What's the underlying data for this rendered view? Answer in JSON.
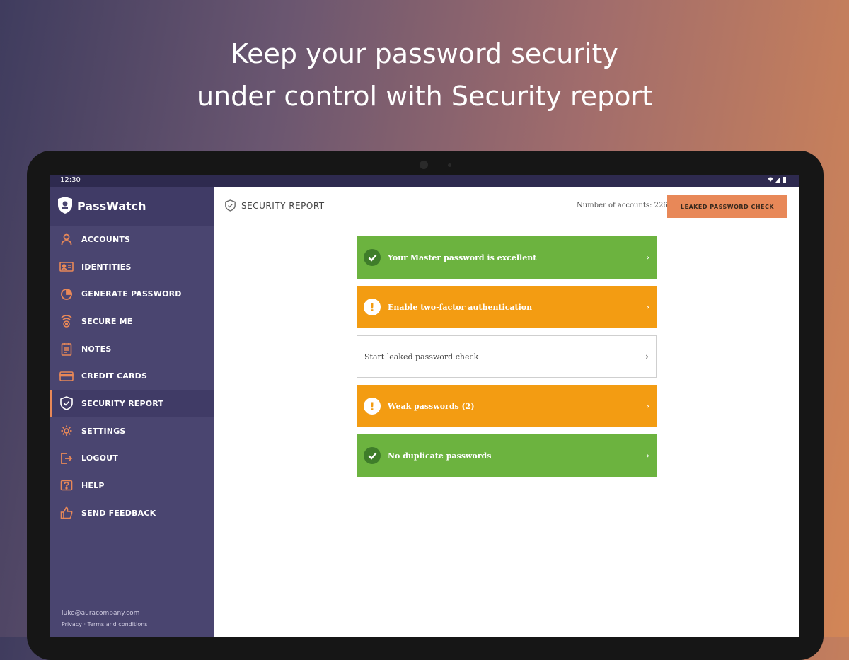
{
  "headline": {
    "line1": "Keep your password security",
    "line2": "under control with Security report"
  },
  "status_bar": {
    "time": "12:30"
  },
  "app": {
    "name": "PassWatch"
  },
  "sidebar": {
    "items": [
      {
        "label": "ACCOUNTS",
        "icon": "user-icon"
      },
      {
        "label": "IDENTITIES",
        "icon": "id-card-icon"
      },
      {
        "label": "GENERATE PASSWORD",
        "icon": "password-generator-icon"
      },
      {
        "label": "SECURE ME",
        "icon": "secure-me-icon"
      },
      {
        "label": "NOTES",
        "icon": "notes-icon"
      },
      {
        "label": "CREDIT CARDS",
        "icon": "credit-card-icon"
      },
      {
        "label": "SECURITY REPORT",
        "icon": "shield-check-icon",
        "active": true
      },
      {
        "label": "SETTINGS",
        "icon": "gear-icon"
      },
      {
        "label": "LOGOUT",
        "icon": "logout-icon"
      },
      {
        "label": "HELP",
        "icon": "help-icon"
      },
      {
        "label": "SEND FEEDBACK",
        "icon": "thumbs-up-icon"
      }
    ],
    "footer": {
      "email": "luke@auracompany.com",
      "privacy": "Privacy",
      "separator": "·",
      "terms": "Terms and conditions"
    }
  },
  "topbar": {
    "title": "SECURITY REPORT",
    "accounts_count": "Number of accounts: 226",
    "leaked_button": "LEAKED PASSWORD CHECK"
  },
  "report_items": [
    {
      "label": "Your Master password is excellent",
      "status": "good"
    },
    {
      "label": "Enable two-factor authentication",
      "status": "warning"
    },
    {
      "label": "Start leaked password check",
      "status": "neutral"
    },
    {
      "label": "Weak passwords (2)",
      "status": "warning"
    },
    {
      "label": "No duplicate passwords",
      "status": "good"
    }
  ],
  "colors": {
    "accent": "#e88858",
    "sidebar": "#4a4570",
    "good": "#6cb33f",
    "warning": "#f39c12"
  }
}
